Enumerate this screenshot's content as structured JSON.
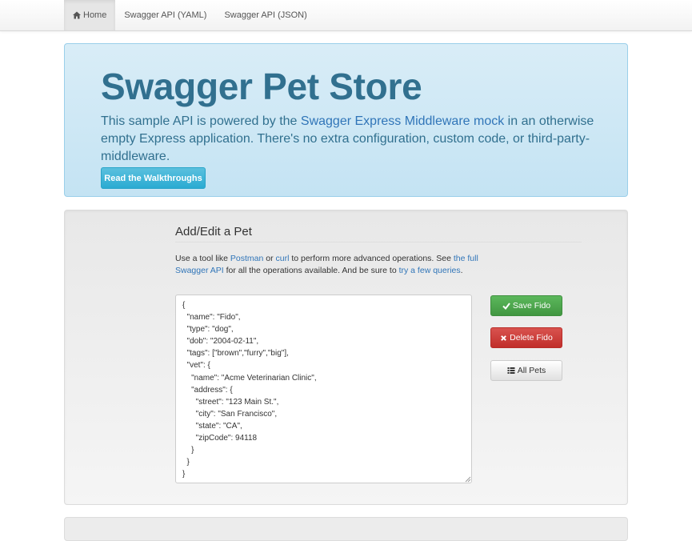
{
  "nav": {
    "items": [
      {
        "label": "Home",
        "icon": "home-icon",
        "active": true
      },
      {
        "label": "Swagger API (YAML)",
        "active": false
      },
      {
        "label": "Swagger API (JSON)",
        "active": false
      }
    ]
  },
  "jumbotron": {
    "title": "Swagger Pet Store",
    "text_before": "This sample API is powered by the ",
    "link_label": "Swagger Express Middleware mock",
    "text_after": " in an otherwise empty Express application. There's no extra configuration, custom code, or third-party-middleware.",
    "button_label": "Read the Walkthroughs"
  },
  "editor_section": {
    "title": "Add/Edit a Pet",
    "help": {
      "t1": "Use a tool like ",
      "link_postman": "Postman",
      "t2": " or ",
      "link_curl": "curl",
      "t3": " to perform more advanced operations. See ",
      "link_swagger": "the full Swagger API",
      "t4": " for all the operations available. And be sure to ",
      "link_queries": "try a few queries",
      "t5": "."
    },
    "json_value": "{\n  \"name\": \"Fido\",\n  \"type\": \"dog\",\n  \"dob\": \"2004-02-11\",\n  \"tags\": [\"brown\",\"furry\",\"big\"],\n  \"vet\": {\n    \"name\": \"Acme Veterinarian Clinic\",\n    \"address\": {\n      \"street\": \"123 Main St.\",\n      \"city\": \"San Francisco\",\n      \"state\": \"CA\",\n      \"zipCode\": 94118\n    }\n  }\n}",
    "save_label": "Save Fido",
    "delete_label": "Delete Fido",
    "all_pets_label": "All Pets"
  },
  "colors": {
    "jumbotron_text": "#31708f",
    "link": "#3075b8",
    "success": "#5cb85c",
    "danger": "#d9534f",
    "info": "#5bc0de"
  },
  "icons": {
    "home": "home-icon",
    "save": "checkmark-icon",
    "delete": "x-icon",
    "all_pets": "list-icon"
  }
}
